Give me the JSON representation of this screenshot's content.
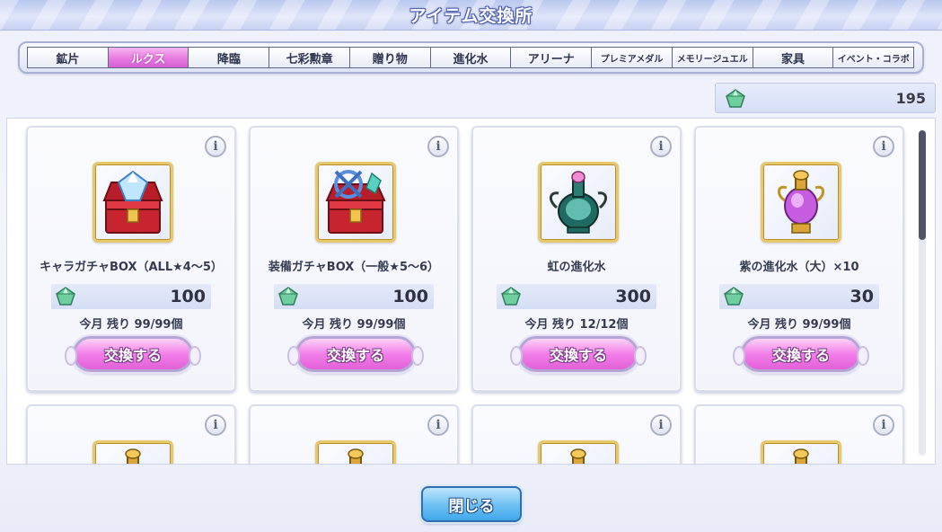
{
  "header": {
    "title": "アイテム交換所"
  },
  "tabs": [
    {
      "label": "鉱片",
      "active": false,
      "small": false
    },
    {
      "label": "ルクス",
      "active": true,
      "small": false
    },
    {
      "label": "降臨",
      "active": false,
      "small": false
    },
    {
      "label": "七彩勲章",
      "active": false,
      "small": false
    },
    {
      "label": "贈り物",
      "active": false,
      "small": false
    },
    {
      "label": "進化水",
      "active": false,
      "small": false
    },
    {
      "label": "アリーナ",
      "active": false,
      "small": false
    },
    {
      "label": "プレミアメダル",
      "active": false,
      "small": true
    },
    {
      "label": "メモリージュエル",
      "active": false,
      "small": true
    },
    {
      "label": "家具",
      "active": false,
      "small": false
    },
    {
      "label": "イベント・コラボ",
      "active": false,
      "small": true
    }
  ],
  "currency": {
    "icon": "green-gem-icon",
    "amount": "195"
  },
  "items": [
    {
      "name": "キャラガチャBOX（ALL★4～5）",
      "icon": "treasure-chest-diamond-icon",
      "cost": "100",
      "remain": "今月 残り 99/99個",
      "button": "交換する"
    },
    {
      "name": "装備ガチャBOX（一般★5～6）",
      "icon": "treasure-chest-equipment-icon",
      "cost": "100",
      "remain": "今月 残り 99/99個",
      "button": "交換する"
    },
    {
      "name": "虹の進化水",
      "icon": "rainbow-potion-icon",
      "cost": "300",
      "remain": "今月 残り 12/12個",
      "button": "交換する"
    },
    {
      "name": "紫の進化水（大）×10",
      "icon": "purple-potion-icon",
      "cost": "30",
      "remain": "今月 残り 99/99個",
      "button": "交換する"
    }
  ],
  "info_label": "i",
  "footer": {
    "close_label": "閉じる"
  },
  "colors": {
    "accent_pink": "#e77ae0",
    "close_blue": "#3fa7ea",
    "gem_green": "#5fbf8f"
  }
}
